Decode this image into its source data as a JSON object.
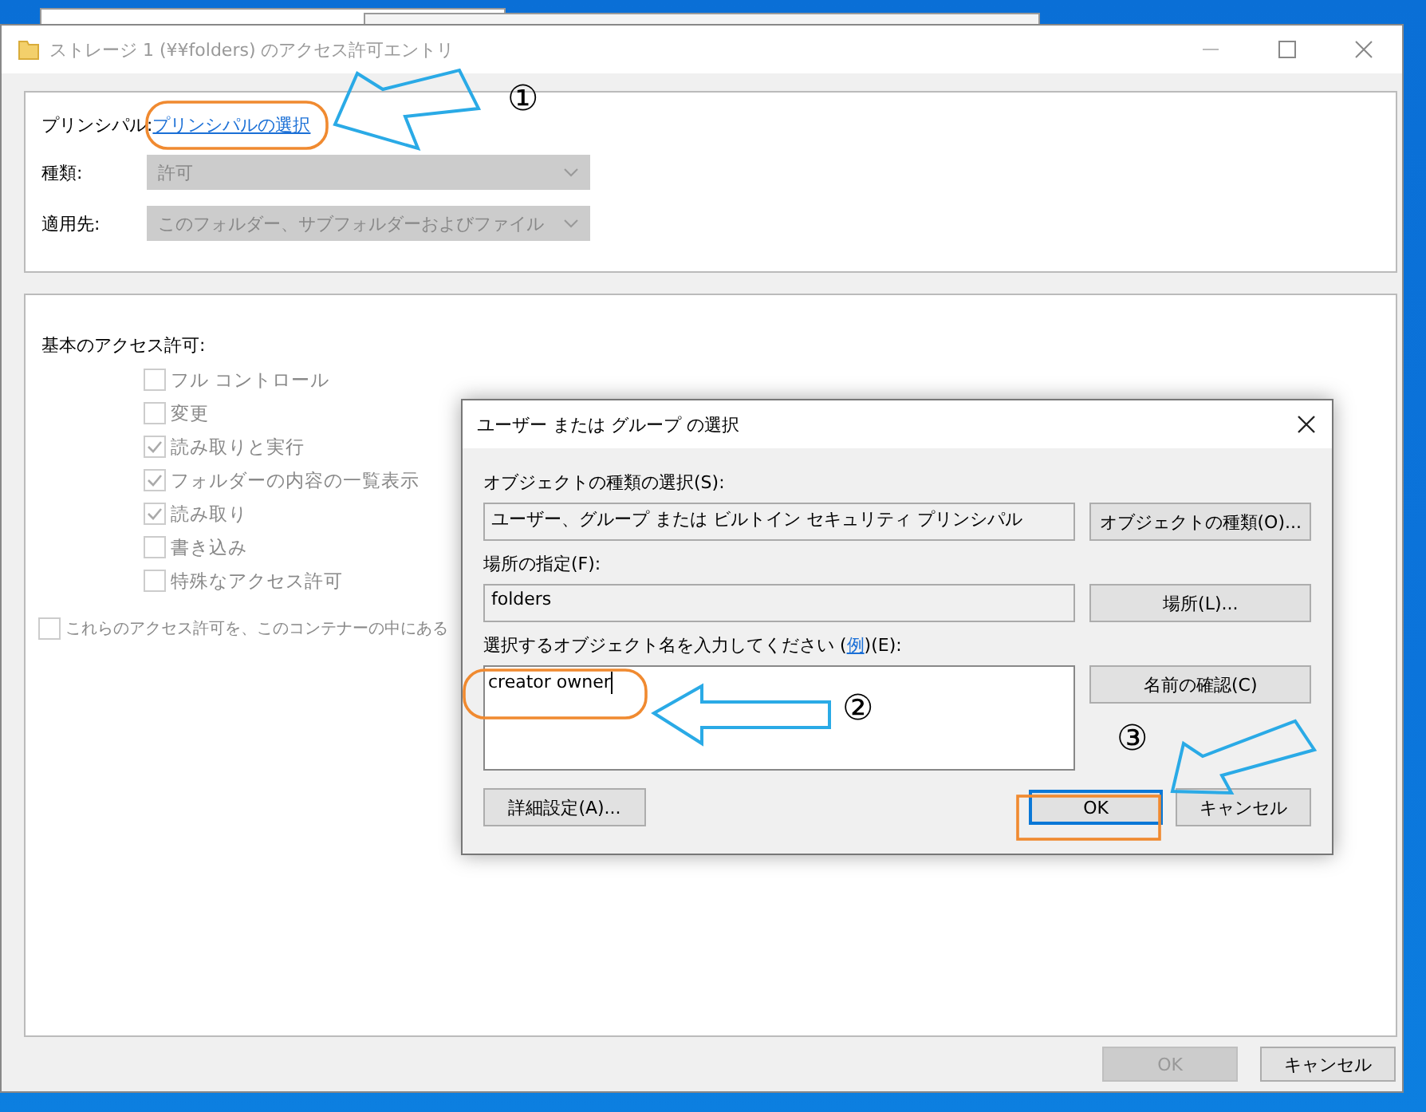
{
  "main_window": {
    "title": "ストレージ 1 (¥¥folders) のアクセス許可エントリ",
    "principal_label": "プリンシパル:",
    "principal_link": "プリンシパルの選択",
    "fields": [
      {
        "label": "種類:",
        "value": "許可",
        "disabled": true
      },
      {
        "label": "適用先:",
        "value": "このフォルダー、サブフォルダーおよびファイル",
        "disabled": true
      }
    ],
    "permissions_heading": "基本のアクセス許可:",
    "permissions": [
      {
        "label": "フル コントロール",
        "checked": false
      },
      {
        "label": "変更",
        "checked": false
      },
      {
        "label": "読み取りと実行",
        "checked": true
      },
      {
        "label": "フォルダーの内容の一覧表示",
        "checked": true
      },
      {
        "label": "読み取り",
        "checked": true
      },
      {
        "label": "書き込み",
        "checked": false
      },
      {
        "label": "特殊なアクセス許可",
        "checked": false
      }
    ],
    "inherit_option": {
      "label": "これらのアクセス許可を、このコンテナーの中にある",
      "checked": false
    },
    "buttons": [
      {
        "label": "OK",
        "disabled": true
      },
      {
        "label": "キャンセル",
        "disabled": false
      }
    ]
  },
  "dialog": {
    "title": "ユーザー または グループ の選択",
    "object_types_label": "オブジェクトの種類の選択(S):",
    "object_types_value": "ユーザー、グループ または ビルトイン セキュリティ プリンシパル",
    "object_types_button": "オブジェクトの種類(O)...",
    "location_label": "場所の指定(F):",
    "location_value": "folders",
    "location_button": "場所(L)...",
    "names_label_before": "選択するオブジェクト名を入力してください (",
    "names_label_link": "例",
    "names_label_after": ")(E):",
    "names_value": "creator owner",
    "check_names_button": "名前の確認(C)",
    "advanced_button": "詳細設定(A)...",
    "ok_button": "OK",
    "cancel_button": "キャンセル"
  },
  "annotations": [
    {
      "label": "①"
    },
    {
      "label": "②"
    },
    {
      "label": "③"
    }
  ]
}
